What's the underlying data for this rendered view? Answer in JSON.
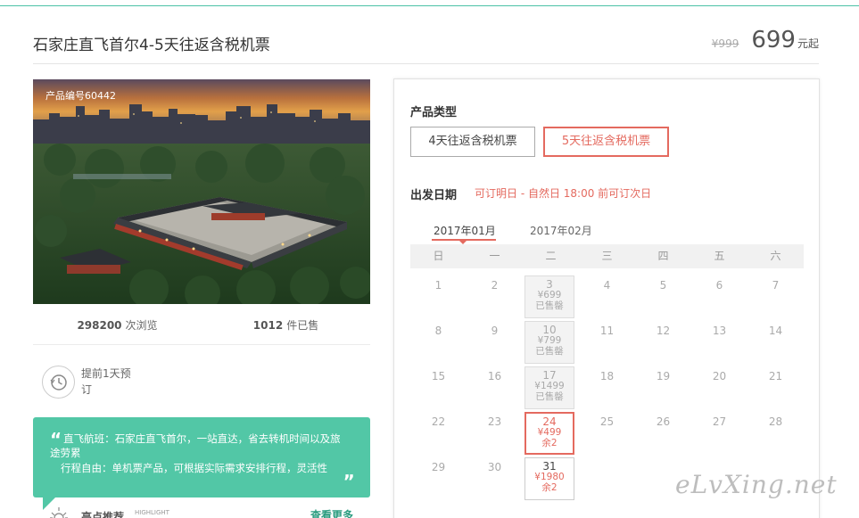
{
  "header": {
    "title": "石家庄直飞首尔4-5天往返含税机票",
    "old_price": "¥999",
    "price": "699",
    "price_suffix": "元起"
  },
  "photo": {
    "product_id": "产品编号60442"
  },
  "stats": {
    "views_count": "298200",
    "views_label": "次浏览",
    "sold_count": "1012",
    "sold_label": "件已售"
  },
  "booking": {
    "advance_text": "提前1天预订"
  },
  "highlights_box": {
    "line1": "直飞航班：石家庄直飞首尔，一站直达，省去转机时间以及旅途劳累",
    "line2": "行程自由：单机票产品，可根据实际需求安排行程，灵活性"
  },
  "highlight_row": {
    "title": "亮点推荐",
    "subtitle": "HIGHLIGHT",
    "more": "查看更多"
  },
  "panel": {
    "type_label": "产品类型",
    "types": [
      "4天往返含税机票",
      "5天往返含税机票"
    ],
    "selected_type": 1,
    "date_label": "出发日期",
    "date_note": "可订明日 - 自然日 18:00 前可订次日",
    "months": [
      "2017年01月",
      "2017年02月"
    ],
    "selected_month": 0,
    "weekdays": [
      "日",
      "一",
      "二",
      "三",
      "四",
      "五",
      "六"
    ],
    "calendar": [
      [
        {
          "d": "1"
        },
        {
          "d": "2"
        },
        {
          "d": "3",
          "price": "¥699",
          "status": "已售罄",
          "state": "sold"
        },
        {
          "d": "4"
        },
        {
          "d": "5"
        },
        {
          "d": "6"
        },
        {
          "d": "7"
        }
      ],
      [
        {
          "d": "8"
        },
        {
          "d": "9"
        },
        {
          "d": "10",
          "price": "¥799",
          "status": "已售罄",
          "state": "sold"
        },
        {
          "d": "11"
        },
        {
          "d": "12"
        },
        {
          "d": "13"
        },
        {
          "d": "14"
        }
      ],
      [
        {
          "d": "15"
        },
        {
          "d": "16"
        },
        {
          "d": "17",
          "price": "¥1499",
          "status": "已售罄",
          "state": "sold"
        },
        {
          "d": "18"
        },
        {
          "d": "19"
        },
        {
          "d": "20"
        },
        {
          "d": "21"
        }
      ],
      [
        {
          "d": "22"
        },
        {
          "d": "23"
        },
        {
          "d": "24",
          "price": "¥499",
          "status": "余2",
          "state": "active"
        },
        {
          "d": "25"
        },
        {
          "d": "26"
        },
        {
          "d": "27"
        },
        {
          "d": "28"
        }
      ],
      [
        {
          "d": "29"
        },
        {
          "d": "30"
        },
        {
          "d": "31",
          "price": "¥1980",
          "status": "余2",
          "state": "normal"
        },
        {
          "d": ""
        },
        {
          "d": ""
        },
        {
          "d": ""
        },
        {
          "d": ""
        }
      ]
    ]
  },
  "watermark": "eLvXing.net",
  "colors": {
    "accent": "#e46a5f",
    "green": "#52c7a6"
  }
}
